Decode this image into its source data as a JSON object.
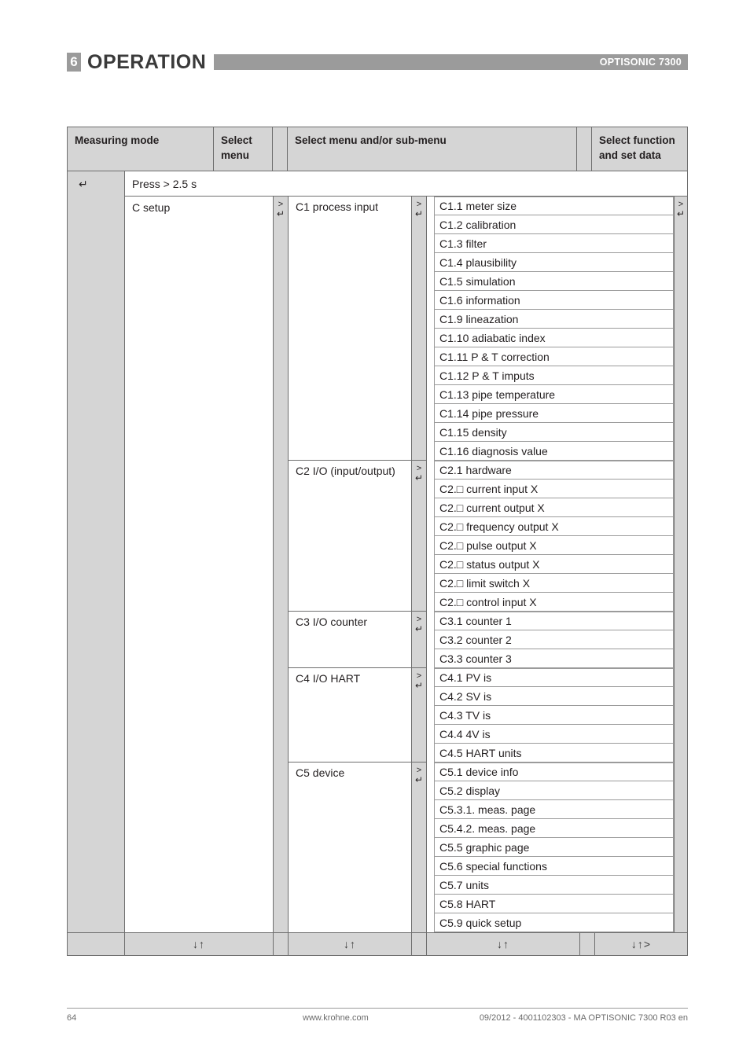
{
  "header": {
    "chapter_number": "6",
    "chapter_title": "OPERATION",
    "product": "OPTISONIC 7300"
  },
  "table": {
    "columns": {
      "measuring_mode": "Measuring mode",
      "select_menu": "Select\nmenu",
      "select_submenu": "Select menu and/or sub-menu",
      "select_function": "Select function\nand set data"
    },
    "enter_symbol": "↵",
    "gt_symbol": ">",
    "press_row": {
      "label": "Press > 2.5 s"
    },
    "setup_label": "C setup",
    "groups": [
      {
        "label": "C1 process input",
        "items": [
          "C1.1 meter size",
          "C1.2 calibration",
          "C1.3 filter",
          "C1.4 plausibility",
          "C1.5 simulation",
          "C1.6 information",
          "C1.9 lineazation",
          "C1.10 adiabatic index",
          "C1.11 P & T correction",
          "C1.12 P & T imputs",
          "C1.13 pipe temperature",
          "C1.14 pipe pressure",
          "C1.15 density",
          "C1.16 diagnosis value"
        ]
      },
      {
        "label": "C2 I/O (input/output)",
        "items": [
          "C2.1 hardware",
          "C2.□ current input X",
          "C2.□ current output X",
          "C2.□ frequency output X",
          "C2.□ pulse output X",
          "C2.□ status output X",
          "C2.□ limit switch X",
          "C2.□ control input X"
        ]
      },
      {
        "label": "C3 I/O counter",
        "items": [
          "C3.1 counter 1",
          "C3.2 counter 2",
          "C3.3 counter 3"
        ]
      },
      {
        "label": "C4 I/O HART",
        "items": [
          "C4.1 PV is",
          "C4.2 SV is",
          "C4.3 TV is",
          "C4.4 4V is",
          "C4.5 HART units"
        ]
      },
      {
        "label": "C5 device",
        "items": [
          "C5.1 device info",
          "C5.2 display",
          "C5.3.1. meas. page",
          "C5.4.2. meas. page",
          "C5.5 graphic page",
          "C5.6 special functions",
          "C5.7 units",
          "C5.8 HART",
          "C5.9 quick setup"
        ]
      }
    ],
    "footer_nav": {
      "menu": "↓↑",
      "sub1": "↓↑",
      "sub2": "↓↑",
      "function": "↓↑>"
    }
  },
  "footer": {
    "page_number": "64",
    "url": "www.krohne.com",
    "meta": "09/2012 - 4001102303 - MA OPTISONIC 7300 R03 en"
  },
  "colors": {
    "gray_fill": "#d5d5d5",
    "bar_gray": "#9b9b9b",
    "border": "#6e6e6e",
    "text": "#231f20"
  }
}
